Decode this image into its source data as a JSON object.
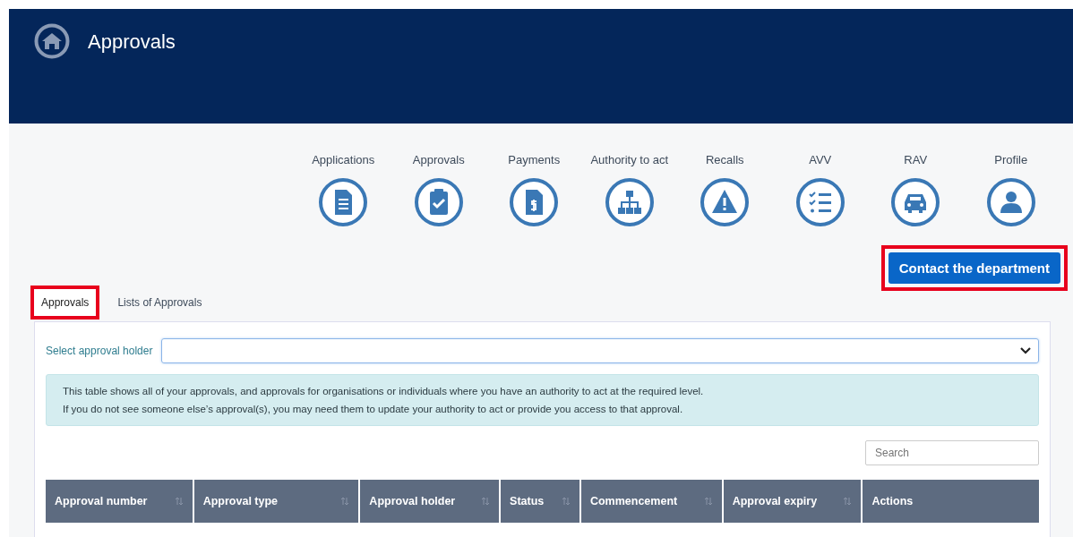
{
  "header": {
    "title": "Approvals"
  },
  "nav": [
    {
      "label": "Applications"
    },
    {
      "label": "Approvals"
    },
    {
      "label": "Payments"
    },
    {
      "label": "Authority to act"
    },
    {
      "label": "Recalls"
    },
    {
      "label": "AVV"
    },
    {
      "label": "RAV"
    },
    {
      "label": "Profile"
    }
  ],
  "contact_button": {
    "label": "Contact the department",
    "highlighted": true
  },
  "tabs": [
    {
      "label": "Approvals",
      "selected": true,
      "highlighted": true
    },
    {
      "label": "Lists of Approvals",
      "selected": false,
      "highlighted": false
    }
  ],
  "holder_select": {
    "label": "Select approval holder"
  },
  "info": [
    "This table shows all of your approvals, and approvals for organisations or individuals where you have an authority to act at the required level.",
    "If you do not see someone else’s approval(s), you may need them to update your authority to act or provide you access to that approval."
  ],
  "search": {
    "placeholder": "Search"
  },
  "table": {
    "columns": [
      {
        "label": "Approval number",
        "sortable": true
      },
      {
        "label": "Approval type",
        "sortable": true
      },
      {
        "label": "Approval holder",
        "sortable": true
      },
      {
        "label": "Status",
        "sortable": true
      },
      {
        "label": "Commencement",
        "sortable": true
      },
      {
        "label": "Approval expiry",
        "sortable": true
      },
      {
        "label": "Actions",
        "sortable": false
      }
    ]
  }
}
